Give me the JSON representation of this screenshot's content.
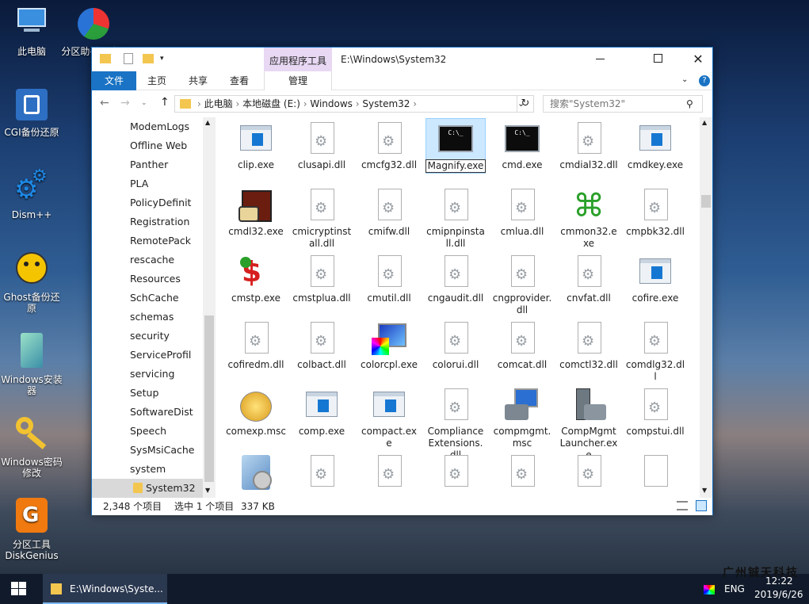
{
  "desktop": {
    "icons": [
      {
        "label": "此电脑",
        "icon": "computer-icon"
      },
      {
        "label": "分区助手(无损)",
        "icon": "partition-assistant-icon"
      },
      {
        "label": "CGI备份还原",
        "icon": "cgi-backup-icon"
      },
      {
        "label": "Dism++",
        "icon": "dism-icon"
      },
      {
        "label": "Ghost备份还原",
        "icon": "ghost-icon"
      },
      {
        "label": "Windows安装器",
        "icon": "windows-installer-icon"
      },
      {
        "label": "Windows密码修改",
        "icon": "key-icon"
      },
      {
        "label": "分区工具DiskGenius",
        "icon": "diskgenius-icon"
      }
    ]
  },
  "window": {
    "context_tab": "应用程序工具",
    "title": "E:\\Windows\\System32",
    "ribbon_tabs": [
      "文件",
      "主页",
      "共享",
      "查看",
      "管理"
    ],
    "breadcrumb": [
      "此电脑",
      "本地磁盘 (E:)",
      "Windows",
      "System32"
    ],
    "search_placeholder": "搜索\"System32\"",
    "nav_items": [
      "ModemLogs",
      "Offline Web",
      "Panther",
      "PLA",
      "PolicyDefinit",
      "Registration",
      "RemotePack",
      "rescache",
      "Resources",
      "SchCache",
      "schemas",
      "security",
      "ServiceProfil",
      "servicing",
      "Setup",
      "SoftwareDist",
      "Speech",
      "SysMsiCache",
      "system",
      "System32"
    ],
    "selected_nav": "System32",
    "files": [
      {
        "name": "clip.exe",
        "type": "exe"
      },
      {
        "name": "clusapi.dll",
        "type": "dll"
      },
      {
        "name": "cmcfg32.dll",
        "type": "dll"
      },
      {
        "name": "Magnify.exe",
        "type": "cmd",
        "selected": true
      },
      {
        "name": "cmd.exe",
        "type": "cmd"
      },
      {
        "name": "cmdial32.dll",
        "type": "dll"
      },
      {
        "name": "cmdkey.exe",
        "type": "exe"
      },
      {
        "name": "cmdl32.exe",
        "type": "phone"
      },
      {
        "name": "cmicryptinstall.dll",
        "type": "dll"
      },
      {
        "name": "cmifw.dll",
        "type": "dll"
      },
      {
        "name": "cmipnpinstall.dll",
        "type": "dll"
      },
      {
        "name": "cmlua.dll",
        "type": "dll"
      },
      {
        "name": "cmmon32.exe",
        "type": "cmmon"
      },
      {
        "name": "cmpbk32.dll",
        "type": "dll"
      },
      {
        "name": "cmstp.exe",
        "type": "cmstp"
      },
      {
        "name": "cmstplua.dll",
        "type": "dll"
      },
      {
        "name": "cmutil.dll",
        "type": "dll"
      },
      {
        "name": "cngaudit.dll",
        "type": "dll"
      },
      {
        "name": "cngprovider.dll",
        "type": "dll"
      },
      {
        "name": "cnvfat.dll",
        "type": "dll"
      },
      {
        "name": "cofire.exe",
        "type": "exe"
      },
      {
        "name": "cofiredm.dll",
        "type": "dll"
      },
      {
        "name": "colbact.dll",
        "type": "dll"
      },
      {
        "name": "colorcpl.exe",
        "type": "color"
      },
      {
        "name": "colorui.dll",
        "type": "dll"
      },
      {
        "name": "comcat.dll",
        "type": "dll"
      },
      {
        "name": "comctl32.dll",
        "type": "dll"
      },
      {
        "name": "comdlg32.dll",
        "type": "dll"
      },
      {
        "name": "comexp.msc",
        "type": "comexp"
      },
      {
        "name": "comp.exe",
        "type": "exe"
      },
      {
        "name": "compact.exe",
        "type": "exe"
      },
      {
        "name": "ComplianceExtensions.dll",
        "type": "dll"
      },
      {
        "name": "compmgmt.msc",
        "type": "compmgmt"
      },
      {
        "name": "CompMgmtLauncher.exe",
        "type": "compmgmt2"
      },
      {
        "name": "compstui.dll",
        "type": "dll"
      },
      {
        "name": "",
        "type": "installer"
      },
      {
        "name": "",
        "type": "dll"
      },
      {
        "name": "",
        "type": "dll"
      },
      {
        "name": "",
        "type": "dll"
      },
      {
        "name": "",
        "type": "dll"
      },
      {
        "name": "",
        "type": "dll"
      },
      {
        "name": "",
        "type": "blank"
      }
    ],
    "status_count": "2,348 个项目",
    "status_selected": "选中 1 个项目",
    "status_size": "337 KB"
  },
  "taskbar": {
    "task_label": "E:\\Windows\\Syste...",
    "lang": "ENG",
    "time": "12:22",
    "date": "2019/6/26",
    "watermark": "广州铖天科技"
  },
  "colors": {
    "accent": "#1a73c4",
    "selected_bg": "#cce8ff",
    "context_tab": "#e8d8f4"
  }
}
